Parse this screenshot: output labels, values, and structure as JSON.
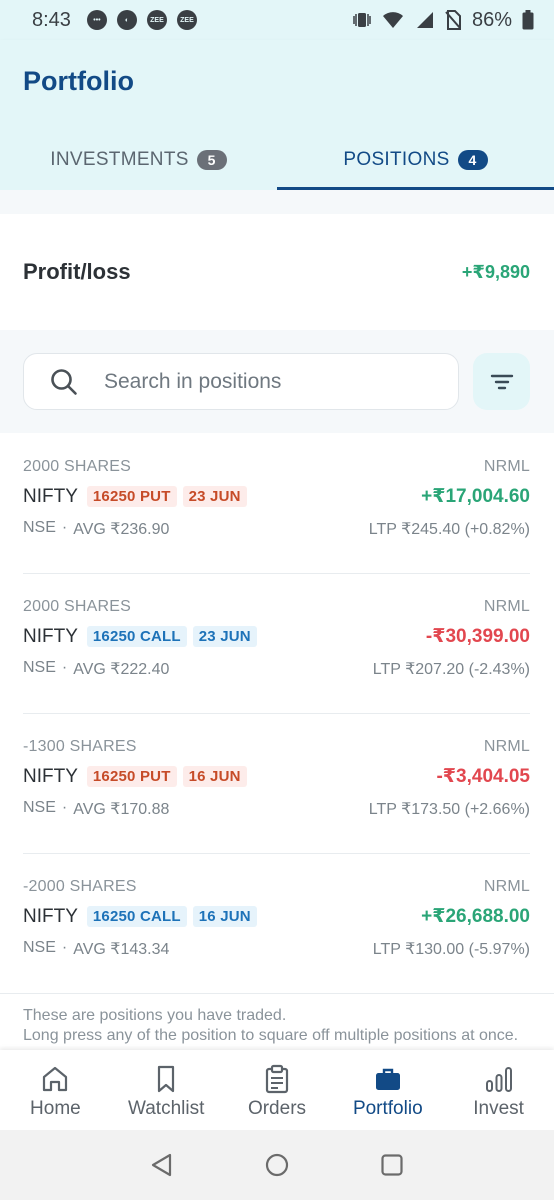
{
  "status_bar": {
    "time": "8:43",
    "notification_labels": [
      "ZEE",
      "ZEE"
    ],
    "battery": "86%"
  },
  "header": {
    "title": "Portfolio",
    "tabs": [
      {
        "label": "INVESTMENTS",
        "count": "5",
        "active": false
      },
      {
        "label": "POSITIONS",
        "count": "4",
        "active": true
      }
    ]
  },
  "summary": {
    "label": "Profit/loss",
    "value": "+₹9,890"
  },
  "search": {
    "placeholder": "Search in positions"
  },
  "positions": [
    {
      "quantity": "2000 SHARES",
      "product": "NRML",
      "symbol": "NIFTY",
      "strike": "16250 PUT",
      "expiry": "23 JUN",
      "pnl": "+₹17,004.60",
      "exchange": "NSE",
      "avg": "AVG ₹236.90",
      "ltp": "LTP ₹245.40 (+0.82%)"
    },
    {
      "quantity": "2000 SHARES",
      "product": "NRML",
      "symbol": "NIFTY",
      "strike": "16250 CALL",
      "expiry": "23 JUN",
      "pnl": "-₹30,399.00",
      "exchange": "NSE",
      "avg": "AVG ₹222.40",
      "ltp": "LTP ₹207.20 (-2.43%)"
    },
    {
      "quantity": "-1300 SHARES",
      "product": "NRML",
      "symbol": "NIFTY",
      "strike": "16250 PUT",
      "expiry": "16 JUN",
      "pnl": "-₹3,404.05",
      "exchange": "NSE",
      "avg": "AVG ₹170.88",
      "ltp": "LTP ₹173.50 (+2.66%)"
    },
    {
      "quantity": "-2000 SHARES",
      "product": "NRML",
      "symbol": "NIFTY",
      "strike": "16250 CALL",
      "expiry": "16 JUN",
      "pnl": "+₹26,688.00",
      "exchange": "NSE",
      "avg": "AVG ₹143.34",
      "ltp": "LTP ₹130.00 (-5.97%)"
    }
  ],
  "footer_note": {
    "line1": "These are positions you have traded.",
    "line2": "Long press any of the position to square off multiple positions at once."
  },
  "bottom_nav": [
    {
      "label": "Home",
      "icon": "home-icon"
    },
    {
      "label": "Watchlist",
      "icon": "bookmark-icon"
    },
    {
      "label": "Orders",
      "icon": "clipboard-icon"
    },
    {
      "label": "Portfolio",
      "icon": "briefcase-icon",
      "active": true
    },
    {
      "label": "Invest",
      "icon": "bar-chart-icon"
    }
  ],
  "colors": {
    "brand": "#124a86",
    "header_bg": "#e3f6f8",
    "profit": "#2aa577",
    "loss": "#e2474f",
    "put_tag": "#c64b28",
    "call_tag": "#1d72b8"
  }
}
